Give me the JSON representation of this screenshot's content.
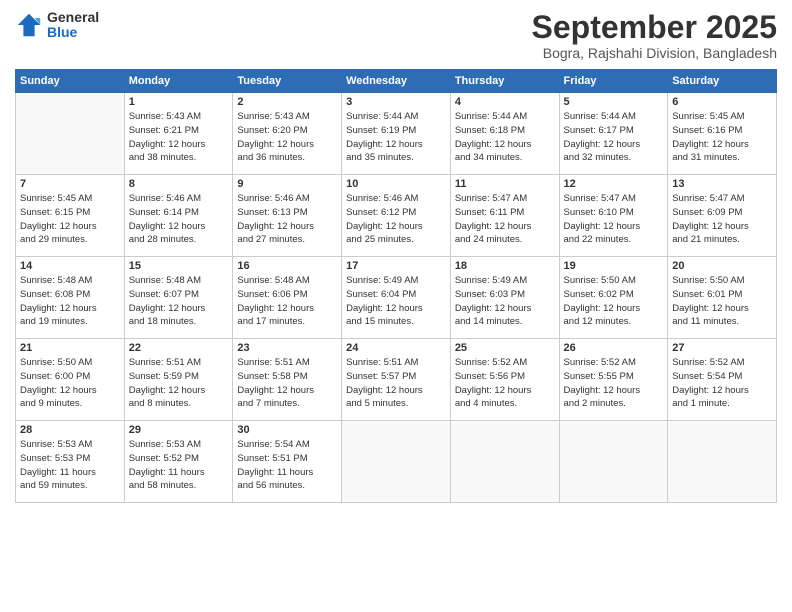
{
  "logo": {
    "general": "General",
    "blue": "Blue"
  },
  "title": "September 2025",
  "subtitle": "Bogra, Rajshahi Division, Bangladesh",
  "weekdays": [
    "Sunday",
    "Monday",
    "Tuesday",
    "Wednesday",
    "Thursday",
    "Friday",
    "Saturday"
  ],
  "weeks": [
    [
      {
        "num": "",
        "info": ""
      },
      {
        "num": "1",
        "info": "Sunrise: 5:43 AM\nSunset: 6:21 PM\nDaylight: 12 hours\nand 38 minutes."
      },
      {
        "num": "2",
        "info": "Sunrise: 5:43 AM\nSunset: 6:20 PM\nDaylight: 12 hours\nand 36 minutes."
      },
      {
        "num": "3",
        "info": "Sunrise: 5:44 AM\nSunset: 6:19 PM\nDaylight: 12 hours\nand 35 minutes."
      },
      {
        "num": "4",
        "info": "Sunrise: 5:44 AM\nSunset: 6:18 PM\nDaylight: 12 hours\nand 34 minutes."
      },
      {
        "num": "5",
        "info": "Sunrise: 5:44 AM\nSunset: 6:17 PM\nDaylight: 12 hours\nand 32 minutes."
      },
      {
        "num": "6",
        "info": "Sunrise: 5:45 AM\nSunset: 6:16 PM\nDaylight: 12 hours\nand 31 minutes."
      }
    ],
    [
      {
        "num": "7",
        "info": "Sunrise: 5:45 AM\nSunset: 6:15 PM\nDaylight: 12 hours\nand 29 minutes."
      },
      {
        "num": "8",
        "info": "Sunrise: 5:46 AM\nSunset: 6:14 PM\nDaylight: 12 hours\nand 28 minutes."
      },
      {
        "num": "9",
        "info": "Sunrise: 5:46 AM\nSunset: 6:13 PM\nDaylight: 12 hours\nand 27 minutes."
      },
      {
        "num": "10",
        "info": "Sunrise: 5:46 AM\nSunset: 6:12 PM\nDaylight: 12 hours\nand 25 minutes."
      },
      {
        "num": "11",
        "info": "Sunrise: 5:47 AM\nSunset: 6:11 PM\nDaylight: 12 hours\nand 24 minutes."
      },
      {
        "num": "12",
        "info": "Sunrise: 5:47 AM\nSunset: 6:10 PM\nDaylight: 12 hours\nand 22 minutes."
      },
      {
        "num": "13",
        "info": "Sunrise: 5:47 AM\nSunset: 6:09 PM\nDaylight: 12 hours\nand 21 minutes."
      }
    ],
    [
      {
        "num": "14",
        "info": "Sunrise: 5:48 AM\nSunset: 6:08 PM\nDaylight: 12 hours\nand 19 minutes."
      },
      {
        "num": "15",
        "info": "Sunrise: 5:48 AM\nSunset: 6:07 PM\nDaylight: 12 hours\nand 18 minutes."
      },
      {
        "num": "16",
        "info": "Sunrise: 5:48 AM\nSunset: 6:06 PM\nDaylight: 12 hours\nand 17 minutes."
      },
      {
        "num": "17",
        "info": "Sunrise: 5:49 AM\nSunset: 6:04 PM\nDaylight: 12 hours\nand 15 minutes."
      },
      {
        "num": "18",
        "info": "Sunrise: 5:49 AM\nSunset: 6:03 PM\nDaylight: 12 hours\nand 14 minutes."
      },
      {
        "num": "19",
        "info": "Sunrise: 5:50 AM\nSunset: 6:02 PM\nDaylight: 12 hours\nand 12 minutes."
      },
      {
        "num": "20",
        "info": "Sunrise: 5:50 AM\nSunset: 6:01 PM\nDaylight: 12 hours\nand 11 minutes."
      }
    ],
    [
      {
        "num": "21",
        "info": "Sunrise: 5:50 AM\nSunset: 6:00 PM\nDaylight: 12 hours\nand 9 minutes."
      },
      {
        "num": "22",
        "info": "Sunrise: 5:51 AM\nSunset: 5:59 PM\nDaylight: 12 hours\nand 8 minutes."
      },
      {
        "num": "23",
        "info": "Sunrise: 5:51 AM\nSunset: 5:58 PM\nDaylight: 12 hours\nand 7 minutes."
      },
      {
        "num": "24",
        "info": "Sunrise: 5:51 AM\nSunset: 5:57 PM\nDaylight: 12 hours\nand 5 minutes."
      },
      {
        "num": "25",
        "info": "Sunrise: 5:52 AM\nSunset: 5:56 PM\nDaylight: 12 hours\nand 4 minutes."
      },
      {
        "num": "26",
        "info": "Sunrise: 5:52 AM\nSunset: 5:55 PM\nDaylight: 12 hours\nand 2 minutes."
      },
      {
        "num": "27",
        "info": "Sunrise: 5:52 AM\nSunset: 5:54 PM\nDaylight: 12 hours\nand 1 minute."
      }
    ],
    [
      {
        "num": "28",
        "info": "Sunrise: 5:53 AM\nSunset: 5:53 PM\nDaylight: 11 hours\nand 59 minutes."
      },
      {
        "num": "29",
        "info": "Sunrise: 5:53 AM\nSunset: 5:52 PM\nDaylight: 11 hours\nand 58 minutes."
      },
      {
        "num": "30",
        "info": "Sunrise: 5:54 AM\nSunset: 5:51 PM\nDaylight: 11 hours\nand 56 minutes."
      },
      {
        "num": "",
        "info": ""
      },
      {
        "num": "",
        "info": ""
      },
      {
        "num": "",
        "info": ""
      },
      {
        "num": "",
        "info": ""
      }
    ]
  ]
}
